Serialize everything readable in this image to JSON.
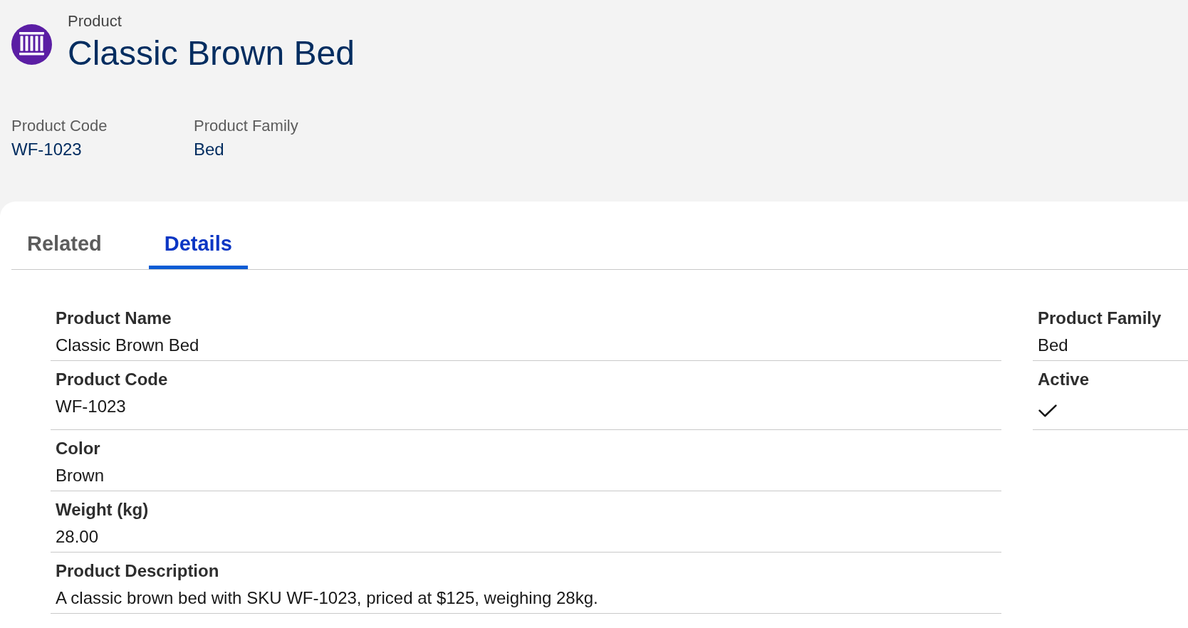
{
  "record": {
    "object_label": "Product",
    "title": "Classic Brown Bed"
  },
  "highlights": [
    {
      "label": "Product Code",
      "value": "WF-1023"
    },
    {
      "label": "Product Family",
      "value": "Bed"
    }
  ],
  "tabs": [
    {
      "label": "Related",
      "selected": false
    },
    {
      "label": "Details",
      "selected": true
    }
  ],
  "details": {
    "left": [
      {
        "label": "Product Name",
        "value": "Classic Brown Bed"
      },
      {
        "label": "Product Code",
        "value": "WF-1023"
      },
      {
        "label": "Color",
        "value": "Brown"
      },
      {
        "label": "Weight (kg)",
        "value": "28.00"
      },
      {
        "label": "Product Description",
        "value": "A classic brown bed with SKU WF-1023, priced at $125, weighing 28kg."
      }
    ],
    "right": [
      {
        "label": "Product Family",
        "kind": "text",
        "value": "Bed"
      },
      {
        "label": "Active",
        "kind": "checkbox",
        "checked": true
      }
    ]
  }
}
